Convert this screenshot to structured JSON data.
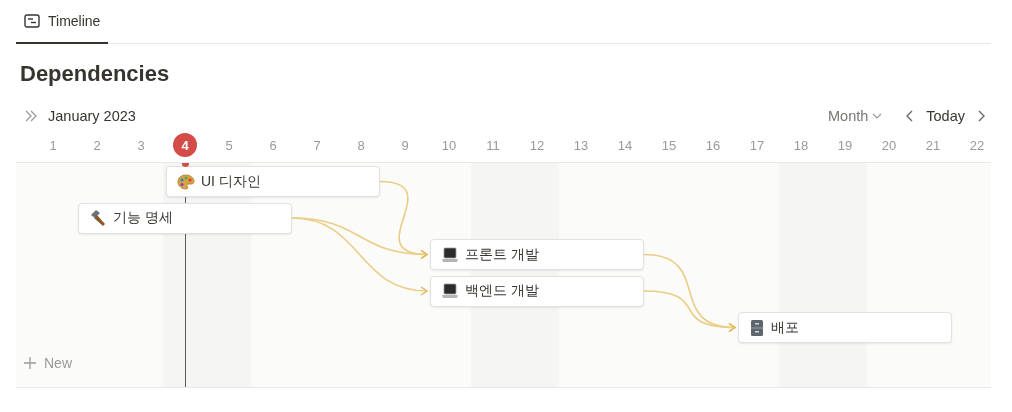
{
  "tabs": [
    {
      "label": "Timeline",
      "selected": true
    }
  ],
  "title": "Dependencies",
  "month": "January 2023",
  "scale": "Month",
  "today_button": "Today",
  "days": [
    {
      "label": "1",
      "shaded": false,
      "today": false
    },
    {
      "label": "2",
      "shaded": false,
      "today": false
    },
    {
      "label": "3",
      "shaded": false,
      "today": false
    },
    {
      "label": "4",
      "shaded": true,
      "today": true
    },
    {
      "label": "5",
      "shaded": true,
      "today": false
    },
    {
      "label": "6",
      "shaded": false,
      "today": false
    },
    {
      "label": "7",
      "shaded": false,
      "today": false
    },
    {
      "label": "8",
      "shaded": false,
      "today": false
    },
    {
      "label": "9",
      "shaded": false,
      "today": false
    },
    {
      "label": "10",
      "shaded": false,
      "today": false
    },
    {
      "label": "11",
      "shaded": true,
      "today": false
    },
    {
      "label": "12",
      "shaded": true,
      "today": false
    },
    {
      "label": "13",
      "shaded": false,
      "today": false
    },
    {
      "label": "14",
      "shaded": false,
      "today": false
    },
    {
      "label": "15",
      "shaded": false,
      "today": false
    },
    {
      "label": "16",
      "shaded": false,
      "today": false
    },
    {
      "label": "17",
      "shaded": false,
      "today": false
    },
    {
      "label": "18",
      "shaded": true,
      "today": false
    },
    {
      "label": "19",
      "shaded": true,
      "today": false
    },
    {
      "label": "20",
      "shaded": false,
      "today": false
    },
    {
      "label": "21",
      "shaded": false,
      "today": false
    },
    {
      "label": "22",
      "shaded": false,
      "today": false
    }
  ],
  "items": [
    {
      "title": "UI 디자인",
      "kind": "palette"
    },
    {
      "title": "기능 명세",
      "kind": "hammer"
    },
    {
      "title": "프론트 개발",
      "kind": "laptop"
    },
    {
      "title": "백엔드 개발",
      "kind": "laptop"
    },
    {
      "title": "배포",
      "kind": "cabinet"
    }
  ],
  "new_label": "New"
}
